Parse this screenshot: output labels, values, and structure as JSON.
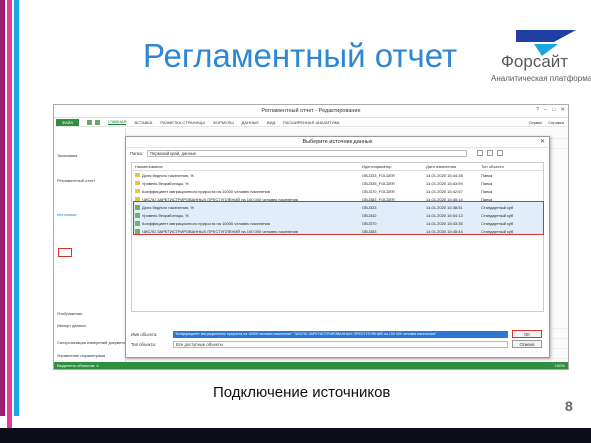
{
  "slide": {
    "title": "Регламентный отчет",
    "caption": "Подключение источников",
    "page_number": "8",
    "logo_name": "Форсайт",
    "logo_subtitle": "Аналитическая платформа",
    "colors": {
      "accent": "#2e86d4",
      "bar1": "#9b1b74",
      "bar2": "#e53b9b",
      "bar3": "#1aa6df",
      "highlight": "#d9312b"
    }
  },
  "app": {
    "window_title": "Регламентный отчет - Редактирование",
    "ribbon_tabs": [
      "ФАЙЛ",
      "ГЛАВНАЯ",
      "ВСТАВКА",
      "РАЗМЕТКА СТРАНИЦЫ",
      "ФОРМУЛЫ",
      "ДАННЫЕ",
      "ВИД",
      "РАСШИРЕННАЯ АНАЛИТИКА"
    ],
    "ribbon_right": [
      "Сервис",
      "Справка"
    ],
    "left_panel": {
      "group_label": "Экономика",
      "report_name": "Регламентный отчет",
      "sources_tab": "Источники",
      "display_label": "Отображение",
      "name_label": "Наименование",
      "import_label": "Импорт данных",
      "sync_label": "Синхронизация измерений документа",
      "params_label": "Управление параметрами"
    },
    "status_bar": {
      "left": "Выделено объектов: 4",
      "right": "100%"
    }
  },
  "dialog": {
    "title": "Выберите источник данных",
    "path_label": "Папка:",
    "path_value": "Пермский край, данные",
    "columns": [
      "Наименование",
      "Идентификатор",
      "Дата изменения",
      "Тип объекта"
    ],
    "rows": [
      {
        "icon": "folder",
        "name": "Доля бедного населения, %",
        "id": "OBJ333_FOLDER",
        "date": "14.01.2020 15:44:38",
        "type": "Папка"
      },
      {
        "icon": "folder",
        "name": "Уровень безработицы, %",
        "id": "OBJ335_FOLDER",
        "date": "14.01.2020 15:43:59",
        "type": "Папка"
      },
      {
        "icon": "folder",
        "name": "Коэффициент миграционного прироста на 10000 человек населения",
        "id": "OBJ370_FOLDER",
        "date": "14.01.2020 15:42:57",
        "type": "Папка"
      },
      {
        "icon": "folder",
        "name": "ЧИСЛО ЗАРЕГИСТРИРОВАННЫХ ПРЕСТУПЛЕНИЙ на 100 000 человек населения",
        "id": "OBJ383_FOLDER",
        "date": "14.01.2020 15:45:14",
        "type": "Папка"
      },
      {
        "icon": "cube",
        "name": "Доля бедного населения, %",
        "id": "OBJ333",
        "date": "14.01.2020 15:38:51",
        "type": "Стандартный куб"
      },
      {
        "icon": "cube",
        "name": "Уровень безработицы, %",
        "id": "OBJ342",
        "date": "14.01.2020 16:04:13",
        "type": "Стандартный куб"
      },
      {
        "icon": "cube",
        "name": "Коэффициент миграционного прироста на 10000 человек населения",
        "id": "OBJ370",
        "date": "14.01.2020 15:43:35",
        "type": "Стандартный куб"
      },
      {
        "icon": "cube",
        "name": "ЧИСЛО ЗАРЕГИСТРИРОВАННЫХ ПРЕСТУПЛЕНИЙ на 100 000 человек населения",
        "id": "OBJ383",
        "date": "14.01.2020 15:45:44",
        "type": "Стандартный куб"
      }
    ],
    "object_name_label": "Имя объекта:",
    "object_name_value": "\"Коэффициент миграционного прироста на 10000 человек населения\" \"ЧИСЛО ЗАРЕГИСТРИРОВАННЫХ ПРЕСТУПЛЕНИЙ на 100 000 человек населения\"",
    "object_type_label": "Тип объекта:",
    "object_type_value": "Все доступные объекты",
    "ok_label": "OK",
    "cancel_label": "Отмена"
  }
}
